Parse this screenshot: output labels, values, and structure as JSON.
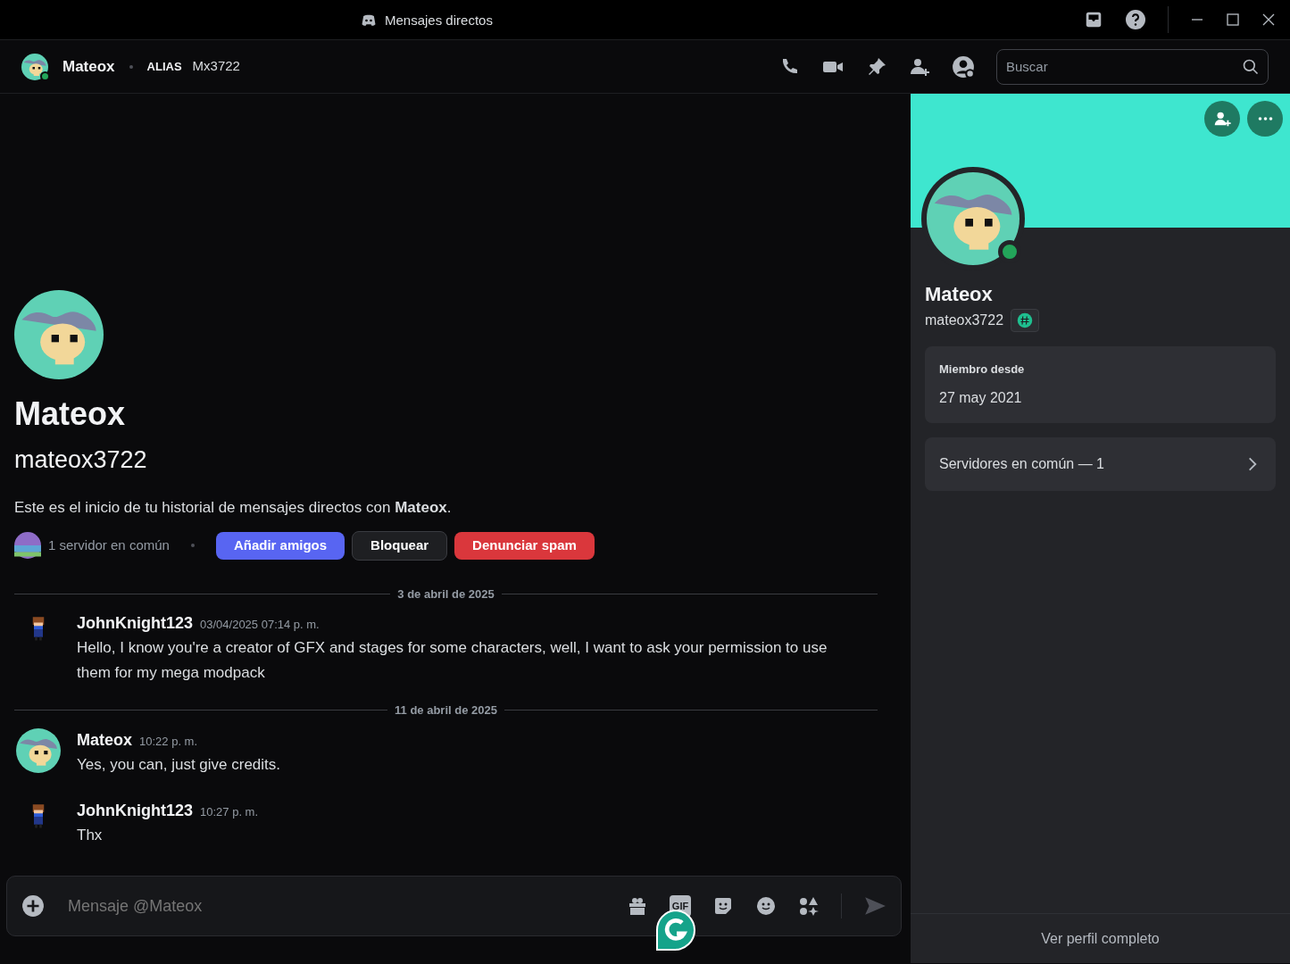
{
  "window": {
    "title": "Mensajes directos"
  },
  "header": {
    "name": "Mateox",
    "alias_label": "ALIAS",
    "alias": "Mx3722",
    "search": {
      "placeholder": "Buscar"
    }
  },
  "intro": {
    "name": "Mateox",
    "username": "mateox3722",
    "text": "Este es el inicio de tu historial de mensajes directos con **Mateox**.",
    "mutual": "1 servidor en común",
    "buttons": [
      {
        "label": "Añadir amigos",
        "kind": "primary"
      },
      {
        "label": "Bloquear",
        "kind": "secondary"
      },
      {
        "label": "Denunciar spam",
        "kind": "danger"
      }
    ]
  },
  "messages": [
    {
      "kind": "divider",
      "label": "3 de abril de 2025"
    },
    {
      "kind": "message",
      "author": "JohnKnight123",
      "pixel_avatar": true,
      "time": "03/04/2025 07:14 p. m.",
      "text": "Hello, I know you're a creator of GFX and stages for some characters, well, I want to ask your permission to use them for my mega modpack"
    },
    {
      "kind": "divider",
      "label": "11 de abril de 2025"
    },
    {
      "kind": "message",
      "author": "Mateox",
      "pixel_avatar": false,
      "time": "10:22 p. m.",
      "text": "Yes, you can, just give credits."
    },
    {
      "kind": "message",
      "author": "JohnKnight123",
      "pixel_avatar": true,
      "time": "10:27 p. m.",
      "text": "Thx"
    }
  ],
  "composer": {
    "placeholder": "Mensaje @Mateox",
    "gif_label": "GIF"
  },
  "profile": {
    "name": "Mateox",
    "username": "mateox3722",
    "member_label": "Miembro desde",
    "member_since": "27 may 2021",
    "mutual_servers": "Servidores en común — 1",
    "footer": "Ver perfil completo"
  }
}
